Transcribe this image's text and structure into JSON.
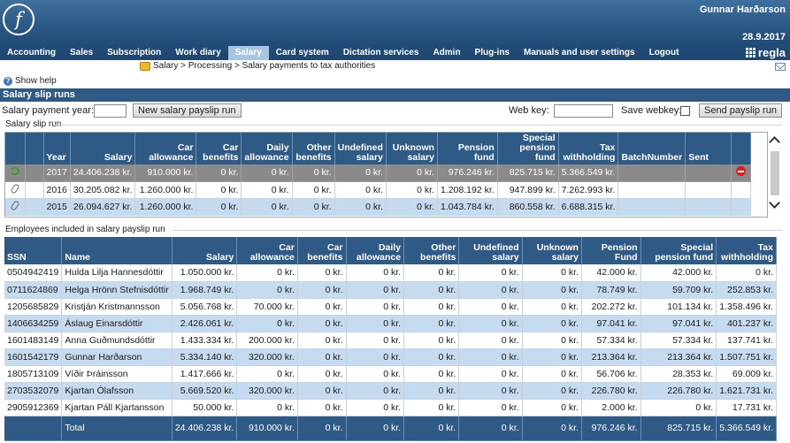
{
  "header": {
    "logo_letter": "f",
    "user_name": "Gunnar Harðarson",
    "date": "28.9.2017",
    "brand": "regla",
    "menu": [
      "Accounting",
      "Sales",
      "Subscription",
      "Work diary",
      "Salary",
      "Card system",
      "Dictation services",
      "Admin",
      "Plug-ins",
      "Manuals and user settings",
      "Logout"
    ],
    "active_menu": "Salary"
  },
  "breadcrumb": "Salary > Processing > Salary payments to tax authorities",
  "help_label": "Show help",
  "section_title": "Salary slip runs",
  "controls": {
    "year_label": "Salary payment year:",
    "year_value": "",
    "new_run_button": "New salary payslip run",
    "web_key_label": "Web key:",
    "web_key_value": "",
    "save_webkey_label": "Save webkey:",
    "send_button": "Send payslip run"
  },
  "runs_group_label": "Salary slip run",
  "runs_table": {
    "columns": [
      "",
      "",
      "Year",
      "Salary",
      "Car allowance",
      "Car benefits",
      "Daily allowance",
      "Other benefits",
      "Undefined salary",
      "Unknown salary",
      "Pension fund",
      "Special pension fund",
      "Tax withholding",
      "BatchNumber",
      "Sent",
      ""
    ],
    "rows": [
      {
        "icon": "refresh-icon",
        "year": "2017",
        "salary": "24.406.238 kr.",
        "car_allowance": "910.000 kr.",
        "car_benefits": "0 kr.",
        "daily_allowance": "0 kr.",
        "other_benefits": "0 kr.",
        "undefined_salary": "0 kr.",
        "unknown_salary": "0 kr.",
        "pension_fund": "976.246 kr.",
        "special_pension_fund": "825.715 kr.",
        "tax_withholding": "5.366.549 kr.",
        "batch_number": "",
        "sent": "",
        "action": "delete-icon"
      },
      {
        "icon": "paperclip-icon",
        "year": "2016",
        "salary": "30.205.082 kr.",
        "car_allowance": "1.260.000 kr.",
        "car_benefits": "0 kr.",
        "daily_allowance": "0 kr.",
        "other_benefits": "0 kr.",
        "undefined_salary": "0 kr.",
        "unknown_salary": "0 kr.",
        "pension_fund": "1.208.192 kr.",
        "special_pension_fund": "947.899 kr.",
        "tax_withholding": "7.262.993 kr.",
        "batch_number": "",
        "sent": "",
        "action": ""
      },
      {
        "icon": "paperclip-icon",
        "year": "2015",
        "salary": "26.094.627 kr.",
        "car_allowance": "1.260.000 kr.",
        "car_benefits": "0 kr.",
        "daily_allowance": "0 kr.",
        "other_benefits": "0 kr.",
        "undefined_salary": "0 kr.",
        "unknown_salary": "0 kr.",
        "pension_fund": "1.043.784 kr.",
        "special_pension_fund": "860.558 kr.",
        "tax_withholding": "6.688.315 kr.",
        "batch_number": "",
        "sent": "",
        "action": ""
      }
    ]
  },
  "employees_group_label": "Employees included in salary payslip run",
  "employees_table": {
    "columns": [
      "SSN",
      "Name",
      "Salary",
      "Car allowance",
      "Car benefits",
      "Daily allowance",
      "Other benefits",
      "Undefined salary",
      "Unknown salary",
      "Pension Fund",
      "Special pension fund",
      "Tax withholding"
    ],
    "rows": [
      [
        "0504942419",
        "Hulda Lilja Hannesdóttir",
        "1.050.000 kr.",
        "0 kr.",
        "0 kr.",
        "0 kr.",
        "0 kr.",
        "0 kr.",
        "0 kr.",
        "42.000 kr.",
        "42.000 kr.",
        "0 kr."
      ],
      [
        "0711624869",
        "Helga Hrönn Stefnisdóttir",
        "1.968.749 kr.",
        "0 kr.",
        "0 kr.",
        "0 kr.",
        "0 kr.",
        "0 kr.",
        "0 kr.",
        "78.749 kr.",
        "59.709 kr.",
        "252.853 kr."
      ],
      [
        "1205685829",
        "Kristján Kristmannsson",
        "5.056.768 kr.",
        "70.000 kr.",
        "0 kr.",
        "0 kr.",
        "0 kr.",
        "0 kr.",
        "0 kr.",
        "202.272 kr.",
        "101.134 kr.",
        "1.358.496 kr."
      ],
      [
        "1406634259",
        "Áslaug Einarsdóttir",
        "2.426.061 kr.",
        "0 kr.",
        "0 kr.",
        "0 kr.",
        "0 kr.",
        "0 kr.",
        "0 kr.",
        "97.041 kr.",
        "97.041 kr.",
        "401.237 kr."
      ],
      [
        "1601483149",
        "Anna Guðmundsdóttir",
        "1.433.334 kr.",
        "200.000 kr.",
        "0 kr.",
        "0 kr.",
        "0 kr.",
        "0 kr.",
        "0 kr.",
        "57.334 kr.",
        "57.334 kr.",
        "137.741 kr."
      ],
      [
        "1601542179",
        "Gunnar Harðarson",
        "5.334.140 kr.",
        "320.000 kr.",
        "0 kr.",
        "0 kr.",
        "0 kr.",
        "0 kr.",
        "0 kr.",
        "213.364 kr.",
        "213.364 kr.",
        "1.507.751 kr."
      ],
      [
        "1805713109",
        "Víðir Þráinsson",
        "1.417.666 kr.",
        "0 kr.",
        "0 kr.",
        "0 kr.",
        "0 kr.",
        "0 kr.",
        "0 kr.",
        "56.706 kr.",
        "28.353 kr.",
        "69.009 kr."
      ],
      [
        "2703532079",
        "Kjartan Ólafsson",
        "5.669.520 kr.",
        "320.000 kr.",
        "0 kr.",
        "0 kr.",
        "0 kr.",
        "0 kr.",
        "0 kr.",
        "226.780 kr.",
        "226.780 kr.",
        "1.621.731 kr."
      ],
      [
        "2905912369",
        "Kjartan Páll Kjartansson",
        "50.000 kr.",
        "0 kr.",
        "0 kr.",
        "0 kr.",
        "0 kr.",
        "0 kr.",
        "0 kr.",
        "2.000 kr.",
        "0 kr.",
        "17.731 kr."
      ]
    ],
    "total": [
      "",
      "Total",
      "24.406.238 kr.",
      "910.000 kr.",
      "0 kr.",
      "0 kr.",
      "0 kr.",
      "0 kr.",
      "0 kr.",
      "976.246 kr.",
      "825.715 kr.",
      "5.366.549 kr."
    ]
  },
  "colors": {
    "header_blue": "#24507c",
    "table_header": "#2f5a86",
    "row_alt": "#c6daf0",
    "selected_row": "#8a8a8a",
    "active_menu": "#a8c4de"
  }
}
